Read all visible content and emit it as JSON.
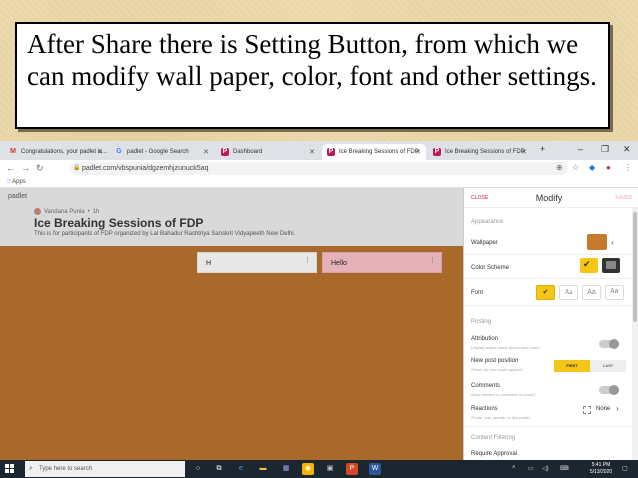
{
  "caption": "After Share there is Setting Button, from which we can modify  wall paper, color, font and other settings.",
  "browser": {
    "tabs": [
      {
        "label": "Congratulations, your padlet is...",
        "icon": "M"
      },
      {
        "label": "padlet - Google Search",
        "icon": "G"
      },
      {
        "label": "Dashboard",
        "icon": "P"
      },
      {
        "label": "Ice Breaking Sessions of FDP",
        "icon": "P",
        "active": true
      },
      {
        "label": "Ice Breaking Sessions of FDP",
        "icon": "P"
      }
    ],
    "new_tab": "+",
    "url": "padlet.com/vbspunia/dgzemhjzunuck5aq",
    "bookmarks_label": "Apps"
  },
  "padlet": {
    "logo": "padlet",
    "author": "Vandana Punia",
    "age": "1h",
    "wall_title": "Ice Breaking Sessions of FDP",
    "wall_description": "This is for participants of FDP organized by Lal Bahadur Rashtriya Sanskrit Vidyapeeth New Delhi.",
    "posts": [
      "H",
      "Hello"
    ],
    "wallpaper_color": "#a9692a"
  },
  "modify_panel": {
    "close": "CLOSE",
    "title": "Modify",
    "save": "SAVED",
    "appearance_header": "Appearance",
    "wallpaper_label": "Wallpaper",
    "wallpaper_swatch": "#c7792c",
    "color_scheme_label": "Color Scheme",
    "font_label": "Font",
    "font_options": [
      "Aa",
      "Aa",
      "Aa"
    ],
    "posting_header": "Posting",
    "attribution_label": "Attribution",
    "attribution_desc": "Display author name above each post?",
    "new_post_label": "New post position",
    "new_post_desc": "Where do new posts appear?",
    "new_post_first": "FIRST",
    "new_post_last": "LAST",
    "comments_label": "Comments",
    "comments_desc": "Allow viewers to comment on posts?",
    "reactions_label": "Reactions",
    "reactions_desc": "Grade, star, upvote, or like posts?",
    "reactions_value": "None",
    "content_filtering_header": "Content Filtering",
    "require_approval_label": "Require Approval",
    "accent_color": "#f5c518"
  },
  "taskbar": {
    "search_placeholder": "Type here to search",
    "time": "5:41 PM",
    "date": "5/13/2020"
  }
}
